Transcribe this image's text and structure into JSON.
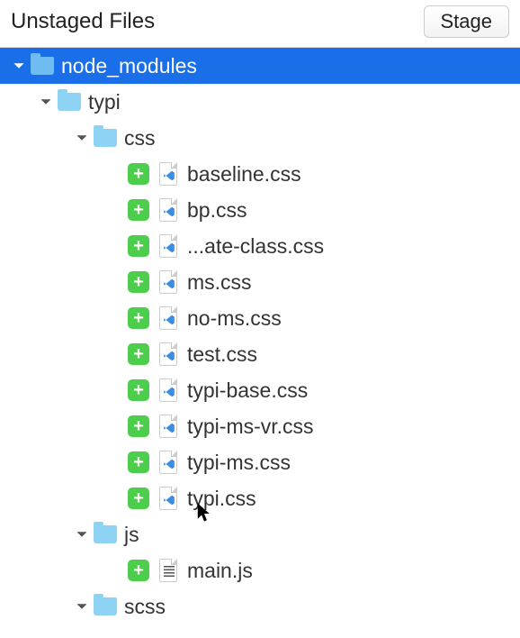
{
  "header": {
    "title": "Unstaged Files",
    "stage_button": "Stage"
  },
  "status_plus": "+",
  "tree": {
    "root": {
      "name": "node_modules"
    },
    "typi": {
      "name": "typi"
    },
    "css": {
      "name": "css"
    },
    "css_files": [
      {
        "name": "baseline.css"
      },
      {
        "name": "bp.css"
      },
      {
        "name": "...ate-class.css"
      },
      {
        "name": "ms.css"
      },
      {
        "name": "no-ms.css"
      },
      {
        "name": "test.css"
      },
      {
        "name": "typi-base.css"
      },
      {
        "name": "typi-ms-vr.css"
      },
      {
        "name": "typi-ms.css"
      },
      {
        "name": "typi.css"
      }
    ],
    "js": {
      "name": "js"
    },
    "js_files": [
      {
        "name": "main.js"
      }
    ],
    "scss": {
      "name": "scss"
    }
  }
}
